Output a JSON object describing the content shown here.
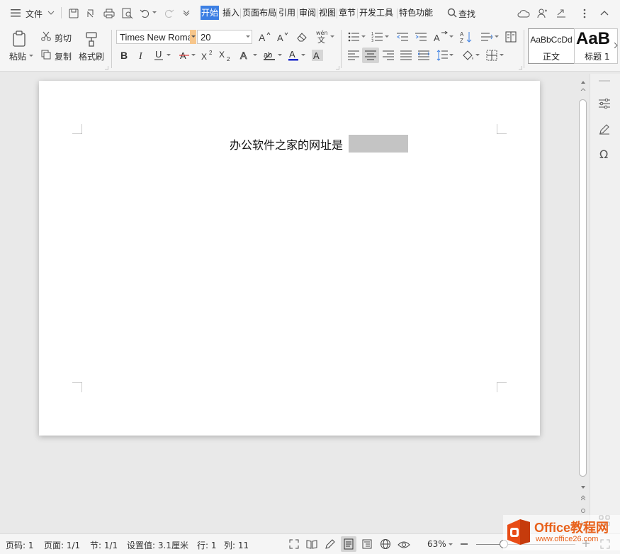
{
  "menubar": {
    "file_label": "文件",
    "tabs": [
      "开始",
      "插入",
      "页面布局",
      "引用",
      "审阅",
      "视图",
      "章节",
      "开发工具",
      "特色功能"
    ],
    "search_label": "查找"
  },
  "clipboard": {
    "paste_label": "粘贴",
    "cut_label": "剪切",
    "copy_label": "复制",
    "format_painter_label": "格式刷"
  },
  "font": {
    "family": "Times New Roma",
    "size": "20"
  },
  "styles": [
    {
      "preview": "AaBbCcDd",
      "name": "正文"
    },
    {
      "preview": "AaB",
      "name": "标题 1"
    }
  ],
  "document": {
    "text": "办公软件之家的网址是"
  },
  "status": {
    "page_number": "页码: 1",
    "pages": "页面: 1/1",
    "section": "节: 1/1",
    "setting": "设置值: 3.1厘米",
    "row": "行: 1",
    "column": "列: 11",
    "zoom": "63%"
  },
  "watermark": {
    "brand": "Office教程网",
    "url": "www.office26.com"
  }
}
